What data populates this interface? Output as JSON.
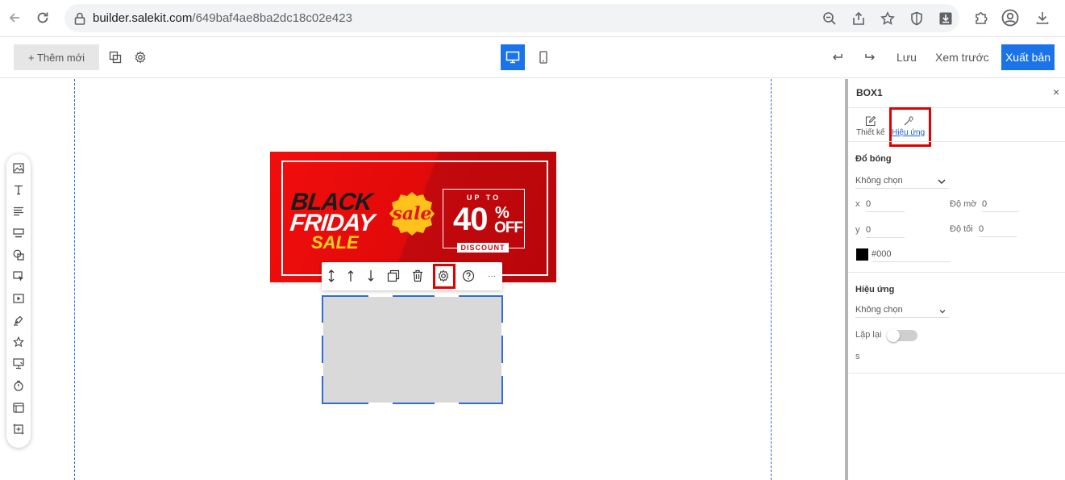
{
  "browser": {
    "url_host": "builder.salekit.com",
    "url_path": "/649baf4ae8ba2dc18c02e423",
    "nav_icons": [
      "back-arrow-icon",
      "reload-icon",
      "lock-icon"
    ],
    "omnibox_icons": [
      "zoom-out-icon",
      "share-icon",
      "star-icon",
      "shield-icon",
      "download-box-icon"
    ],
    "extension_icons": [
      "puzzle-icon",
      "profile-icon",
      "download-icon"
    ]
  },
  "toolbar": {
    "add_label": "+ Thêm mới",
    "undo_icon": "undo-icon",
    "redo_icon": "redo-icon",
    "save_label": "Lưu",
    "preview_label": "Xem trước",
    "publish_label": "Xuất bản",
    "accent_color": "#1a73e8"
  },
  "left_tools": [
    "image-icon",
    "text-icon",
    "paragraph-icon",
    "button-icon",
    "shape-icon",
    "select-icon",
    "video-icon",
    "pen-icon",
    "star-icon",
    "form-icon",
    "timer-icon",
    "gallery-icon",
    "frame-icon"
  ],
  "banner": {
    "line1": "BLACK",
    "line2": "FRIDAY",
    "line3": "SALE",
    "badge": "sale",
    "upto": "UP TO",
    "percent": "40",
    "percent_sign": "%",
    "off": "OFF",
    "discount": "DISCOUNT"
  },
  "element_toolbar": {
    "icons": [
      "resize-vertical-icon",
      "move-up-icon",
      "move-down-icon",
      "duplicate-icon",
      "delete-icon",
      "settings-icon",
      "help-icon",
      "more-icon"
    ],
    "more_label": "···"
  },
  "panel": {
    "title": "BOX1",
    "close": "×",
    "tab_design": "Thiết kế",
    "tab_effects": "Hiệu ứng",
    "shadow_heading": "Đổ bóng",
    "shadow_select": "Không chọn",
    "x_label": "x",
    "x_value": "0",
    "y_label": "y",
    "y_value": "0",
    "blur_label": "Độ mờ",
    "blur_value": "0",
    "dark_label": "Độ tối",
    "dark_value": "0",
    "color_value": "#000",
    "effects_heading": "Hiệu ứng",
    "effects_select": "Không chọn",
    "repeat_label": "Lặp lại",
    "repeat_on": false,
    "unit_label": "s"
  }
}
